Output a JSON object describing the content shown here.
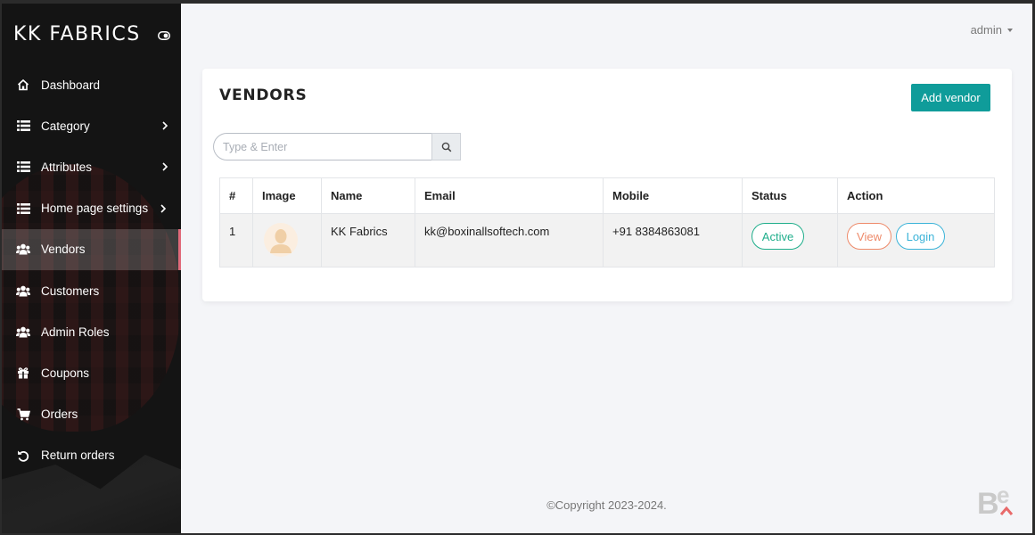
{
  "app": {
    "brand": "KK FABRICS"
  },
  "sidebar": {
    "items": [
      {
        "label": "Dashboard",
        "icon": "home-icon",
        "has_submenu": false
      },
      {
        "label": "Category",
        "icon": "list-icon",
        "has_submenu": true
      },
      {
        "label": "Attributes",
        "icon": "list-icon",
        "has_submenu": true
      },
      {
        "label": "Home page settings",
        "icon": "list-icon",
        "has_submenu": true
      },
      {
        "label": "Vendors",
        "icon": "users-icon",
        "has_submenu": false,
        "active": true
      },
      {
        "label": "Customers",
        "icon": "users-icon",
        "has_submenu": false
      },
      {
        "label": "Admin Roles",
        "icon": "users-icon",
        "has_submenu": false
      },
      {
        "label": "Coupons",
        "icon": "gift-icon",
        "has_submenu": false
      },
      {
        "label": "Orders",
        "icon": "cart-icon",
        "has_submenu": false
      },
      {
        "label": "Return orders",
        "icon": "undo-icon",
        "has_submenu": false
      }
    ]
  },
  "header": {
    "user": "admin"
  },
  "vendors": {
    "title": "VENDORS",
    "add_button": "Add vendor",
    "search": {
      "placeholder": "Type & Enter",
      "value": ""
    },
    "columns": [
      "#",
      "Image",
      "Name",
      "Email",
      "Mobile",
      "Status",
      "Action"
    ],
    "rows": [
      {
        "index": "1",
        "name": "KK Fabrics",
        "email": "kk@boxinallsoftech.com",
        "mobile": "+91 8384863081",
        "status": "Active",
        "actions": {
          "view": "View",
          "login": "Login"
        }
      }
    ]
  },
  "footer": {
    "text": "©Copyright 2023-2024."
  },
  "colors": {
    "accent": "#0f9c9a",
    "active_status": "#1fae8b",
    "view_action": "#ee8a6a",
    "login_action": "#3ab3d8",
    "active_nav_marker": "#e06a7a"
  }
}
